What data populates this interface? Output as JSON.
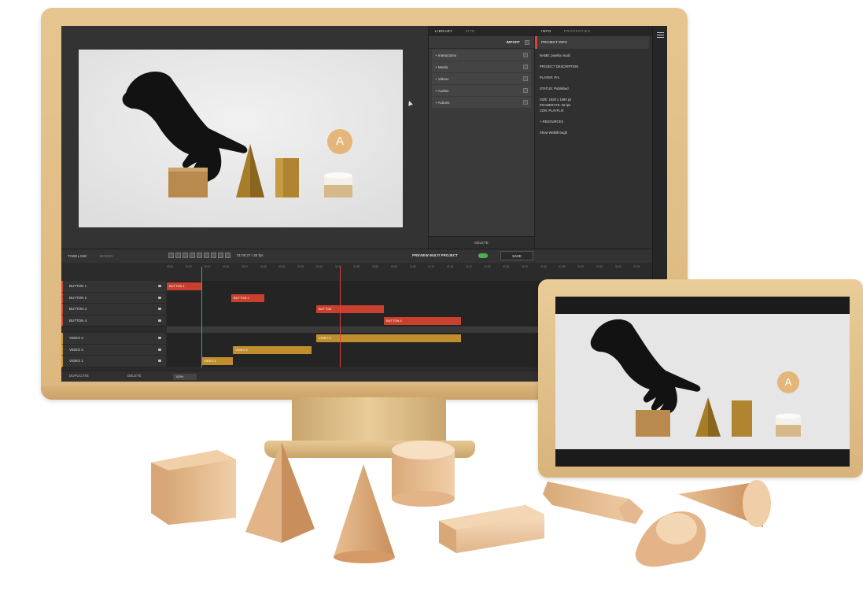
{
  "colors": {
    "frame": "#dcb87f",
    "accent_red": "#d9443a",
    "accent_gold": "#c08e2c",
    "toggle_on": "#4caf50"
  },
  "preview": {
    "logo_letter": "A"
  },
  "library": {
    "tabs": [
      {
        "label": "LIBRARY"
      },
      {
        "label": "SITE"
      }
    ],
    "import_label": "IMPORT",
    "items": [
      {
        "label": "+ Interactions"
      },
      {
        "label": "+ Media"
      },
      {
        "label": "+ Videos"
      },
      {
        "label": "+ Audios"
      },
      {
        "label": "+ Actions"
      }
    ],
    "delete_label": "DELETE"
  },
  "info": {
    "tabs": [
      {
        "label": "INFO"
      },
      {
        "label": "PROPERTIES"
      }
    ],
    "header": "PROJECT INFO",
    "name": "NAME: pixelloo multi",
    "description": "PROJECT DESCRIPTION",
    "player": "PLAYER: Pro",
    "status": "STATUS: Published",
    "size": "SIZE: 1920 x 1080 px",
    "framerate": "FRAMERATE: 25 fps",
    "cdn": "CDN: PLAYFLIX",
    "resources": "+ RESOURCES",
    "walkthrough": "Show Walkthrough"
  },
  "timeline": {
    "tabs": [
      {
        "label": "TIMELINE"
      },
      {
        "label": "MODEL"
      }
    ],
    "timecode": "01:00:27 / 25 fps",
    "preview_label": "PREVIEW MULTI PROJECT",
    "save_label": "SAVE",
    "ruler": [
      "00:00",
      "00:05",
      "00:10",
      "00:15",
      "00:20",
      "00:25",
      "00:30",
      "00:35",
      "00:40",
      "00:45",
      "00:50",
      "00:55",
      "01:00",
      "01:05",
      "01:10",
      "01:15",
      "01:20",
      "01:25",
      "01:30",
      "01:35",
      "01:40",
      "01:45",
      "01:50",
      "01:55",
      "02:00",
      "02:05"
    ],
    "button_tracks": [
      {
        "label": "BUTTON 1",
        "clip": "BUTTON 1"
      },
      {
        "label": "BUTTON 2",
        "clip": "BUTTON 2"
      },
      {
        "label": "BUTTON 3",
        "clip": "BUTTON"
      },
      {
        "label": "BUTTON 4",
        "clip": "BUTTON 4"
      }
    ],
    "video_tracks": [
      {
        "label": "VIDEO 3",
        "clip": "VIDEO 3"
      },
      {
        "label": "VIDEO 2",
        "clip": "VIDEO 2"
      },
      {
        "label": "VIDEO 1",
        "clip": "VIDEO 1"
      }
    ],
    "footer": {
      "duplicate": "DUPLICATE",
      "delete": "DELETE",
      "zoom": "100%"
    }
  }
}
